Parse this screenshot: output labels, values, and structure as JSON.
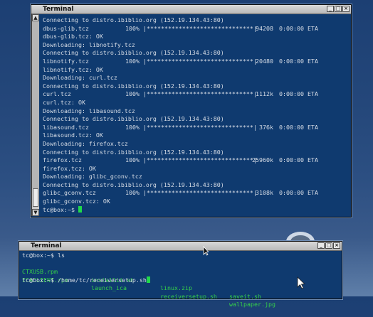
{
  "windows": {
    "main": {
      "title": "Terminal",
      "lines": [
        {
          "c1": "Connecting to distro.ibiblio.org (152.19.134.43:80)"
        },
        {
          "c1": "dbus-glib.tcz",
          "c2": "100% |******************************|",
          "c3": "94208",
          "c4": "0:00:00 ETA"
        },
        {
          "c1": "dbus-glib.tcz: OK"
        },
        {
          "c1": "Downloading: libnotify.tcz"
        },
        {
          "c1": "Connecting to distro.ibiblio.org (152.19.134.43:80)"
        },
        {
          "c1": "libnotify.tcz",
          "c2": "100% |******************************|",
          "c3": "20480",
          "c4": "0:00:00 ETA"
        },
        {
          "c1": "libnotify.tcz: OK"
        },
        {
          "c1": "Downloading: curl.tcz"
        },
        {
          "c1": "Connecting to distro.ibiblio.org (152.19.134.43:80)"
        },
        {
          "c1": "curl.tcz",
          "c2": "100% |******************************|",
          "c3": "1112k",
          "c4": "0:00:00 ETA"
        },
        {
          "c1": "curl.tcz: OK"
        },
        {
          "c1": "Downloading: libasound.tcz"
        },
        {
          "c1": "Connecting to distro.ibiblio.org (152.19.134.43:80)"
        },
        {
          "c1": "libasound.tcz",
          "c2": "100% |******************************|",
          "c3": "376k",
          "c4": "0:00:00 ETA"
        },
        {
          "c1": "libasound.tcz: OK"
        },
        {
          "c1": "Downloading: firefox.tcz"
        },
        {
          "c1": "Connecting to distro.ibiblio.org (152.19.134.43:80)"
        },
        {
          "c1": "firefox.tcz",
          "c2": "100% |******************************|",
          "c3": "25960k",
          "c4": "0:00:00 ETA"
        },
        {
          "c1": "firefox.tcz: OK"
        },
        {
          "c1": "Downloading: glibc_gconv.tcz"
        },
        {
          "c1": "Connecting to distro.ibiblio.org (152.19.134.43:80)"
        },
        {
          "c1": "glibc_gconv.tcz",
          "c2": "100% |******************************|",
          "c3": "3108k",
          "c4": "0:00:00 ETA"
        },
        {
          "c1": "glibc_gconv.tcz: OK"
        }
      ],
      "prompt": "tc@box:~$ "
    },
    "second": {
      "title": "Terminal",
      "line1": "tc@box:~$ ls",
      "files_row1": [
        "CTXUSB.rpm",
        "installit.sh",
        "linux.zip",
        "saveit.sh"
      ],
      "files_row2": [
        "ICACLIENT.rpm",
        "launch_ica",
        "receiversetup.sh",
        "wallpaper.jpg"
      ],
      "prompt_line": "tc@box:~$ /home/tc/receiversetup.sh"
    }
  },
  "logo": {
    "text": "core"
  },
  "icons": [
    "minimize-icon",
    "maximize-icon",
    "close-icon",
    "scroll-up-icon",
    "scroll-down-icon",
    "mouse-pointer-icon"
  ],
  "colors": {
    "terminal_bg": "#0f3a6f",
    "text": "#d7dde6",
    "green": "#35d14a",
    "cursor": "#20d84a"
  }
}
